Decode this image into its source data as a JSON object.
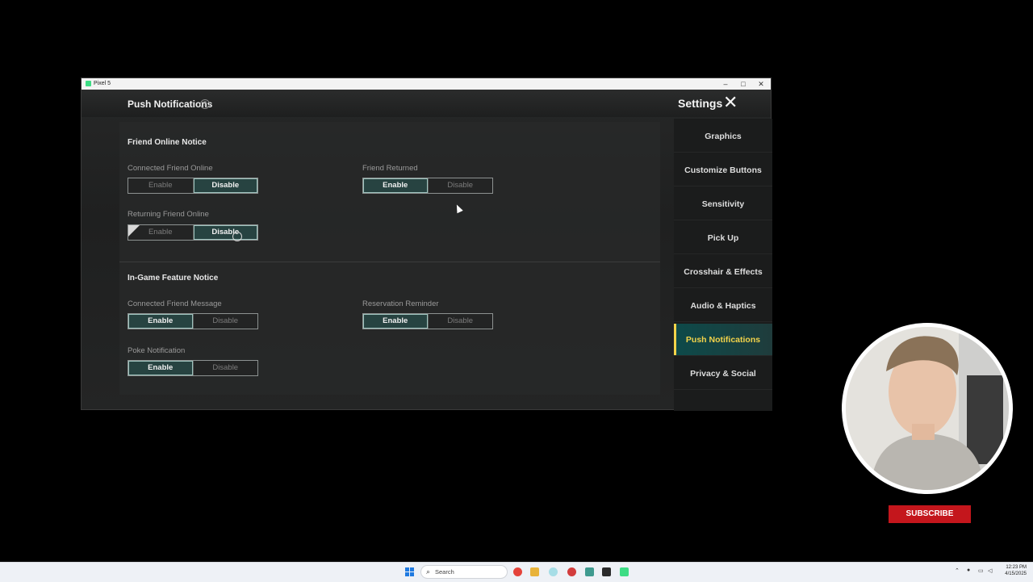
{
  "window": {
    "title": "Pixel 5",
    "min": "–",
    "max": "□",
    "close": "✕"
  },
  "header": {
    "title": "Push Notifications",
    "help": "?",
    "settings": "Settings",
    "close": "✕"
  },
  "sections": [
    {
      "title": "Friend Online Notice"
    },
    {
      "title": "In-Game Feature Notice"
    }
  ],
  "toggles": [
    {
      "label": "Connected Friend Online",
      "enable": "Enable",
      "disable": "Disable",
      "selected": "Disable"
    },
    {
      "label": "Friend Returned",
      "enable": "Enable",
      "disable": "Disable",
      "selected": "Enable"
    },
    {
      "label": "Returning Friend Online",
      "enable": "Enable",
      "disable": "Disable",
      "selected": "Disable"
    },
    {
      "label": "Connected Friend Message",
      "enable": "Enable",
      "disable": "Disable",
      "selected": "Enable"
    },
    {
      "label": "Reservation Reminder",
      "enable": "Enable",
      "disable": "Disable",
      "selected": "Enable"
    },
    {
      "label": "Poke Notification",
      "enable": "Enable",
      "disable": "Disable",
      "selected": "Enable"
    }
  ],
  "sidebar": {
    "items": [
      {
        "label": "Graphics"
      },
      {
        "label": "Customize Buttons"
      },
      {
        "label": "Sensitivity"
      },
      {
        "label": "Pick Up"
      },
      {
        "label": "Crosshair & Effects"
      },
      {
        "label": "Audio & Haptics"
      },
      {
        "label": "Push Notifications",
        "active": true
      },
      {
        "label": "Privacy & Social"
      }
    ]
  },
  "overlay": {
    "subscribe": "SUBSCRIBE"
  },
  "taskbar": {
    "search_placeholder": "Search",
    "time": "12:23 PM",
    "date": "4/15/2025"
  }
}
